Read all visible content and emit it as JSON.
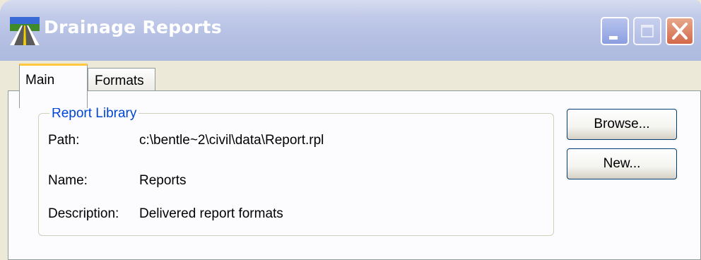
{
  "window": {
    "title": "Drainage Reports",
    "accent": "#0046d5",
    "tab_highlight": "#ffc83c"
  },
  "tabs": [
    {
      "label": "Main",
      "selected": true
    },
    {
      "label": "Formats",
      "selected": false
    }
  ],
  "report_library": {
    "legend": "Report Library",
    "fields": [
      {
        "label": "Path:",
        "value": "c:\\bentle~2\\civil\\data\\Report.rpl"
      },
      {
        "label": "Name:",
        "value": "Reports"
      },
      {
        "label": "Description:",
        "value": "Delivered report formats"
      }
    ]
  },
  "buttons": {
    "browse": "Browse...",
    "new": "New..."
  },
  "icons": {
    "app": "road-icon",
    "minimize": "minimize-icon",
    "maximize": "maximize-icon",
    "close": "close-icon"
  }
}
